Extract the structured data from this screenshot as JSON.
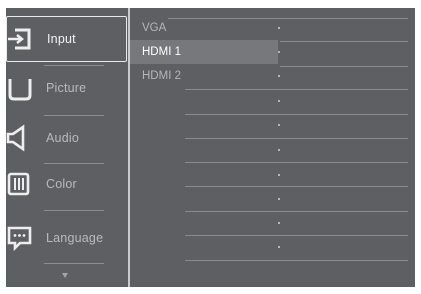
{
  "menu": {
    "items": [
      {
        "label": "Input",
        "icon": "input-icon",
        "selected": true
      },
      {
        "label": "Picture",
        "icon": "picture-icon",
        "selected": false
      },
      {
        "label": "Audio",
        "icon": "audio-icon",
        "selected": false
      },
      {
        "label": "Color",
        "icon": "color-icon",
        "selected": false
      },
      {
        "label": "Language",
        "icon": "language-icon",
        "selected": false
      }
    ],
    "scroll_icon": "chevron-down-icon"
  },
  "submenu": {
    "items": [
      {
        "label": "VGA",
        "selected": false
      },
      {
        "label": "HDMI 1",
        "selected": true
      },
      {
        "label": "HDMI 2",
        "selected": false
      }
    ]
  },
  "colors": {
    "panel_bg": "#5e5f62",
    "selected_row": "#77787b",
    "text": "#b9babc",
    "selected_text": "#ffffff"
  }
}
